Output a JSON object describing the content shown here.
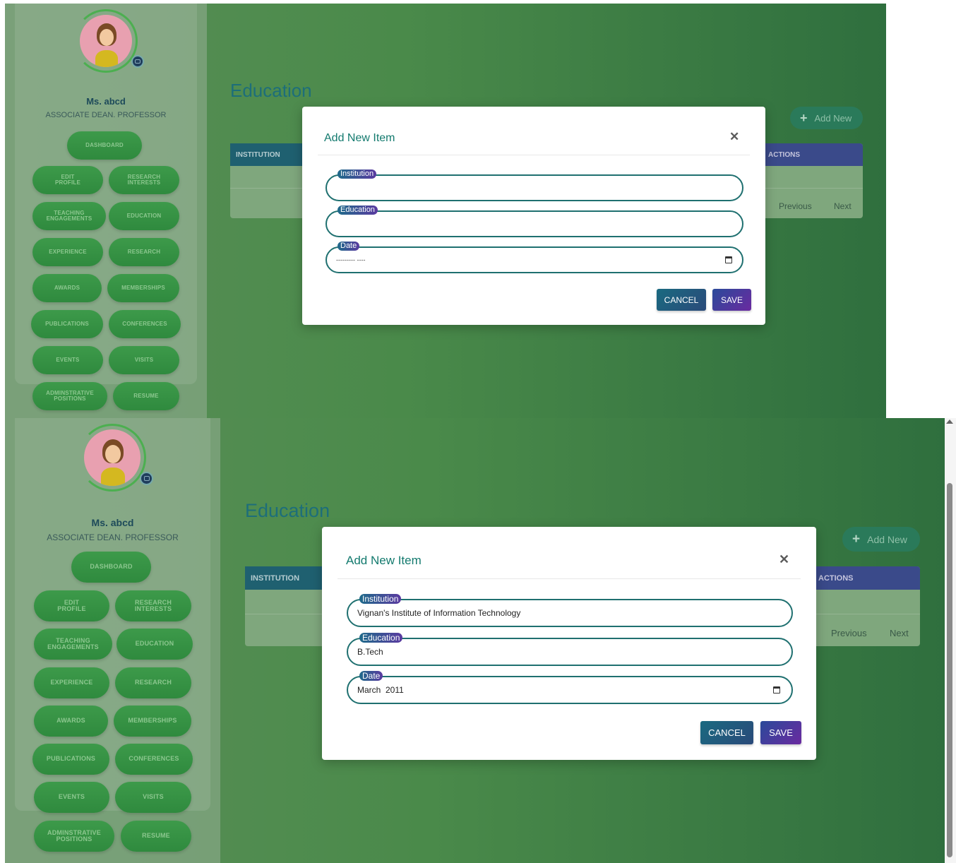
{
  "profile": {
    "name": "Ms. abcd",
    "role": "ASSOCIATE DEAN. PROFESSOR"
  },
  "sidebar": {
    "dashboard": "DASHBOARD",
    "items": [
      {
        "label": "EDIT\nPROFILE"
      },
      {
        "label": "RESEARCH\nINTERESTS"
      },
      {
        "label": "TEACHING\nENGAGEMENTS"
      },
      {
        "label": "EDUCATION"
      },
      {
        "label": "EXPERIENCE"
      },
      {
        "label": "RESEARCH"
      },
      {
        "label": "AWARDS"
      },
      {
        "label": "MEMBERSHIPS"
      },
      {
        "label": "PUBLICATIONS"
      },
      {
        "label": "CONFERENCES"
      },
      {
        "label": "EVENTS"
      },
      {
        "label": "VISITS"
      },
      {
        "label": "ADMINSTRATIVE\nPOSITIONS"
      },
      {
        "label": "RESUME"
      }
    ]
  },
  "main": {
    "title": "Education",
    "add_new": "Add New",
    "table": {
      "col_first": "INSTITUTION",
      "col_last": "ACTIONS"
    },
    "pager": {
      "previous": "Previous",
      "next": "Next"
    }
  },
  "modal": {
    "title": "Add New Item",
    "close_icon": "close-icon",
    "fields": {
      "institution_label": "Institution",
      "education_label": "Education",
      "date_label": "Date"
    },
    "empty_state": {
      "institution_value": "",
      "education_value": "",
      "date_placeholder": "--------- ----"
    },
    "filled_state": {
      "institution_value": "Vignan's Institute of Information Technology",
      "education_value": "B.Tech",
      "date_value": "March  2011"
    },
    "cancel": "CANCEL",
    "save": "SAVE"
  },
  "colors": {
    "accent_teal": "#137a6e",
    "field_border": "#1f7070",
    "sidebar_pill": "#2f8a3e"
  }
}
